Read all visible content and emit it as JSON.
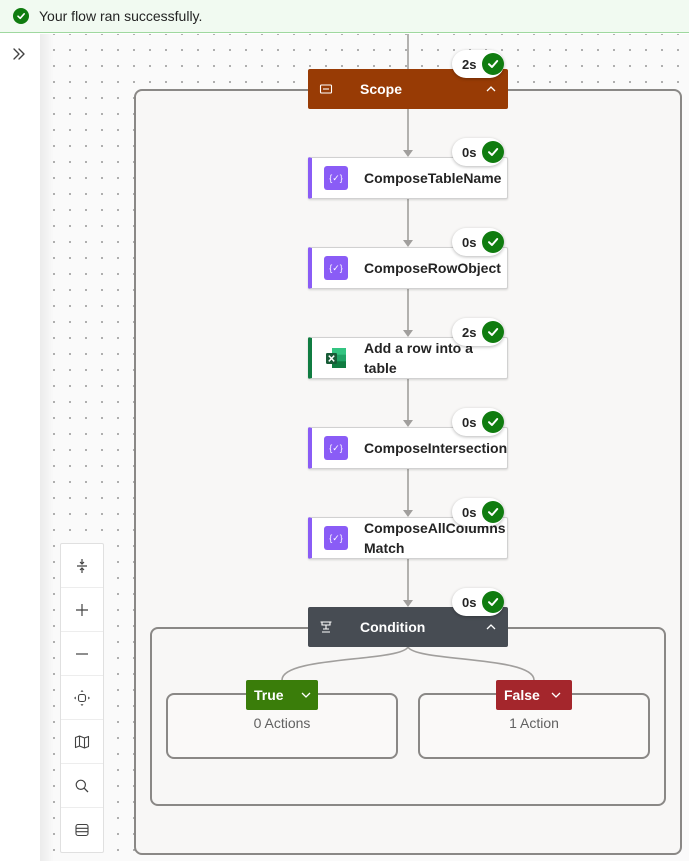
{
  "banner": {
    "message": "Your flow ran successfully.",
    "status_color": "#107c10"
  },
  "flow": {
    "scope": {
      "title": "Scope",
      "duration": "2s",
      "color": "#983b05"
    },
    "actions": [
      {
        "title": "ComposeTableName",
        "duration": "0s",
        "kind": "compose"
      },
      {
        "title": "ComposeRowObject",
        "duration": "0s",
        "kind": "compose"
      },
      {
        "title": "Add a row into a table",
        "duration": "2s",
        "kind": "excel"
      },
      {
        "title": "ComposeIntersection",
        "duration": "0s",
        "kind": "compose"
      },
      {
        "title": "ComposeAllColumns Match",
        "duration": "0s",
        "kind": "compose"
      }
    ],
    "condition": {
      "title": "Condition",
      "duration": "0s",
      "color": "#474c53",
      "true_branch": {
        "label": "True",
        "count": "0 Actions",
        "color": "#3a7d0a"
      },
      "false_branch": {
        "label": "False",
        "count": "1 Action",
        "color": "#a4262c"
      }
    }
  },
  "toolbar": {
    "buttons": [
      "fit-height-icon",
      "zoom-in-icon",
      "zoom-out-icon",
      "fit-view-icon",
      "minimap-icon",
      "search-icon",
      "collapse-all-icon"
    ]
  }
}
